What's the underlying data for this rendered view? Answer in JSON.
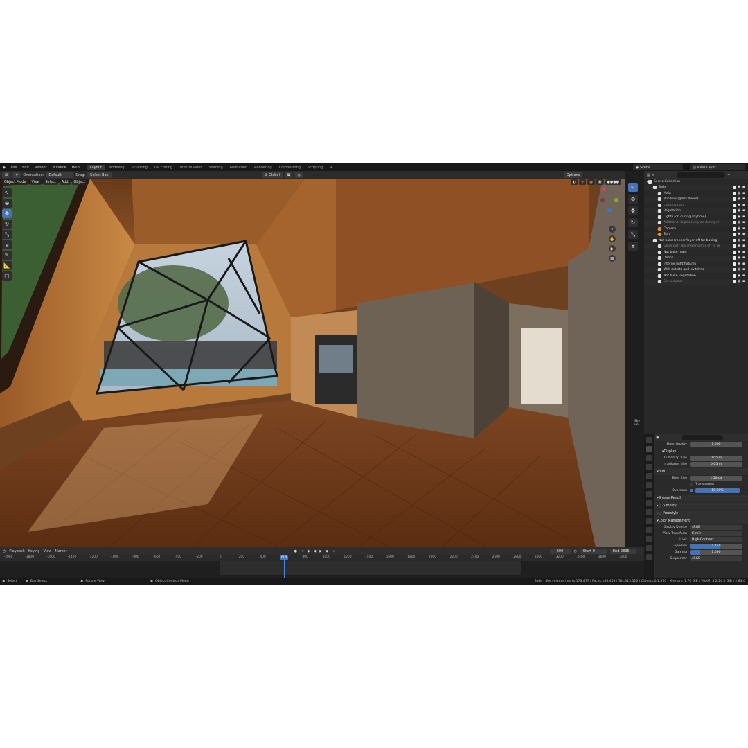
{
  "app": {
    "menu": [
      "File",
      "Edit",
      "Render",
      "Window",
      "Help"
    ],
    "workspaces": [
      "Layout",
      "Modeling",
      "Sculpting",
      "UV Editing",
      "Texture Paint",
      "Shading",
      "Animation",
      "Rendering",
      "Compositing",
      "Scripting"
    ],
    "active_workspace": "Layout",
    "add_workspace": "+",
    "scene": "Scene",
    "view_layer": "View Layer"
  },
  "viewport": {
    "orientation_label": "Orientation:",
    "orientation_value": "Default",
    "drag_label": "Drag:",
    "drag_value": "Select Box",
    "transform_orientation": "Global",
    "options": "Options",
    "mode": "Object Mode",
    "header_menus": [
      "View",
      "Select",
      "Add",
      "Object"
    ],
    "colors": {
      "wood_dark": "#5a3418",
      "wood_mid": "#8c5426",
      "wood_light": "#c98a45",
      "floor": "#7a3f1c",
      "wall_gray": "#6e6255",
      "sky": "#b9c9d8"
    }
  },
  "outliner": {
    "rows": [
      {
        "label": "Scene Collection",
        "indent": 0,
        "icon": "coll",
        "dim": false,
        "flags": false
      },
      {
        "label": "Bake",
        "indent": 1,
        "icon": "coll",
        "dim": false,
        "flags": true
      },
      {
        "label": "Main",
        "indent": 2,
        "icon": "coll",
        "dim": false,
        "flags": true
      },
      {
        "label": "Windows(glass doors)",
        "indent": 2,
        "icon": "coll",
        "dim": false,
        "flags": true
      },
      {
        "label": "Lighting data",
        "indent": 2,
        "icon": "coll",
        "dim": true,
        "flags": true
      },
      {
        "label": "Vegetation",
        "indent": 2,
        "icon": "coll",
        "dim": false,
        "flags": true
      },
      {
        "label": "Lights (on during daytime)",
        "indent": 2,
        "icon": "coll",
        "dim": false,
        "flags": true
      },
      {
        "label": "Additional Lights (only on during ni",
        "indent": 2,
        "icon": "coll",
        "dim": true,
        "flags": true
      },
      {
        "label": "Camera",
        "indent": 2,
        "icon": "cam",
        "dim": false,
        "flags": true
      },
      {
        "label": "Sun",
        "indent": 2,
        "icon": "sun",
        "dim": false,
        "flags": true
      },
      {
        "label": "Not bake (render/layer off for baking)",
        "indent": 1,
        "icon": "coll",
        "dim": false,
        "flags": true
      },
      {
        "label": "Glass part (no shading this off to re",
        "indent": 2,
        "icon": "coll",
        "dim": true,
        "flags": true
      },
      {
        "label": "Not bake main",
        "indent": 2,
        "icon": "coll",
        "dim": false,
        "flags": true
      },
      {
        "label": "Doors",
        "indent": 2,
        "icon": "coll",
        "dim": false,
        "flags": true
      },
      {
        "label": "Interior light fixtures",
        "indent": 2,
        "icon": "coll",
        "dim": false,
        "flags": true
      },
      {
        "label": "Wall outlets and switches",
        "indent": 2,
        "icon": "coll",
        "dim": false,
        "flags": true
      },
      {
        "label": "Not bake vegetation",
        "indent": 2,
        "icon": "coll",
        "dim": false,
        "flags": true
      },
      {
        "label": "Sky volume",
        "indent": 2,
        "icon": "coll",
        "dim": true,
        "flags": true
      }
    ]
  },
  "side_labels": {
    "sky_vo": "Sky vo",
    "dayli": "Dayli"
  },
  "properties": {
    "filter_quality_label": "Filter Quality",
    "filter_quality_value": "1.000",
    "display_section": "Display",
    "cubemap_size_label": "Cubemap Size",
    "cubemap_size_value": "0.05 m",
    "irradiance_size_label": "Irradiance Size",
    "irradiance_size_value": "0.05 m",
    "film_section": "Film",
    "filter_size_label": "Filter Size",
    "filter_size_value": "1.50 px",
    "transparent_label": "Transparent",
    "overscan_label": "Overscan",
    "overscan_value": "10.00%",
    "grease_pencil": "Grease Pencil",
    "simplify": "Simplify",
    "freestyle": "Freestyle",
    "color_management": "Color Management",
    "display_device_label": "Display Device",
    "display_device_value": "sRGB",
    "view_transform_label": "View Transform",
    "view_transform_value": "Filmic",
    "look_label": "Look",
    "look_value": "High Contrast",
    "exposure_label": "Exposure",
    "exposure_value": "1.440",
    "gamma_label": "Gamma",
    "gamma_value": "1.000",
    "sequencer_label": "Sequencer",
    "sequencer_value": "sRGB"
  },
  "timeline": {
    "menus": [
      "Playback",
      "Keying",
      "View",
      "Marker"
    ],
    "current_frame": "600",
    "start_label": "Start",
    "start_value": "0",
    "end_label": "End",
    "end_value": "2835",
    "ticks": [
      "-2000",
      "-1800",
      "-1600",
      "-1400",
      "-1200",
      "-1000",
      "-800",
      "-600",
      "-400",
      "-200",
      "0",
      "200",
      "400",
      "600",
      "800",
      "1000",
      "1200",
      "1400",
      "1600",
      "1800",
      "2000",
      "2200",
      "2400",
      "2600",
      "2800",
      "3000",
      "3200",
      "3400",
      "3600",
      "3800"
    ],
    "playhead_frame": 600
  },
  "status": {
    "select": "Select",
    "box_select": "Box Select",
    "rotate_view": "Rotate View",
    "context_menu": "Object Context Menu",
    "stats": "Bake | Sky volume | Verts:173,477 | Faces:156,459 | Tris:313,513 | Objects:0/1,570 | Memory: 1.76 GiB | VRAM: 3.2/24.0 GiB | 2.83.0"
  }
}
